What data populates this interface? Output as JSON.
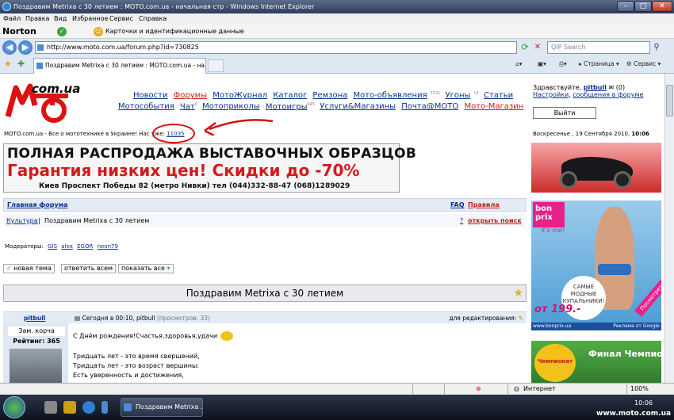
{
  "window": {
    "title": "Поздравим Metrixa с 30 летием : MOTO.com.ua - начальная стр - Windows Internet Explorer"
  },
  "menu": [
    "Файл",
    "Правка",
    "Вид",
    "Избранное",
    "Сервис",
    "Справка"
  ],
  "norton": {
    "logo": "Norton",
    "identity": "Карточки и идентификационные данные"
  },
  "address": {
    "url": "http://www.moto.com.ua/forum.php?id=730825",
    "search_placeholder": "QIP Search"
  },
  "tab": {
    "label": "Поздравим Metrixa с 30 летием : MOTO.com.ua - на..."
  },
  "tools": {
    "page": "Страница",
    "service": "Сервис"
  },
  "site": {
    "logo": "com.ua",
    "nav_row1": [
      {
        "label": "Новости",
        "sup": ""
      },
      {
        "label": "Форумы",
        "sup": ""
      },
      {
        "label": "МотоЖурнал",
        "sup": ""
      },
      {
        "label": "Каталог",
        "sup": ""
      },
      {
        "label": "Ремзона",
        "sup": ""
      },
      {
        "label": "Мото-объявления",
        "sup": "1531"
      },
      {
        "label": "Угоны",
        "sup": "14"
      },
      {
        "label": "Статьи",
        "sup": ""
      }
    ],
    "nav_row2": [
      {
        "label": "Мотособытия",
        "sup": ""
      },
      {
        "label": "Чат",
        "sup": "0"
      },
      {
        "label": "Мотоприколы",
        "sup": ""
      },
      {
        "label": "Мотоигры",
        "sup": "445"
      },
      {
        "label": "Услуги&Магазины",
        "sup": ""
      },
      {
        "label": "Почта@MOTO",
        "sup": ""
      },
      {
        "label": "Мото-Магазин",
        "sup": ""
      }
    ],
    "tagline": "MOTO.com.ua - Все о мототехнике в Украине!  Нас уже:",
    "user_count": "11035",
    "greeting": "Здравствуйте,",
    "username": "pitbull",
    "pm_count": "(0)",
    "settings": "Настройки",
    "forum_msgs": "сообщения в форуме",
    "logout": "Выйти",
    "date": "Воскресенье , 19 Сентября 2010,",
    "time": "10:06"
  },
  "banner": {
    "line1": "ПОЛНАЯ РАСПРОДАЖА ВЫСТАВОЧНЫХ ОБРАЗЦОВ",
    "line2": "Гарантия низких цен! Скидки до -70%",
    "line3": "Киев  Проспект Победы 82 (метро Нивки) тел (044)332-88-47 (068)1289029"
  },
  "ads": {
    "bonprix_logo": "bon prix",
    "bonprix_tag": "it's me!",
    "bonprix_circle": "САМЫЕ МОДНЫЕ КУПАЛЬНИКИ!",
    "bonprix_ribbon": "Посмотреть!",
    "bonprix_price": "от 199.-",
    "bonprix_url": "www.bonprix.ua",
    "bonprix_google": "Реклама от Google",
    "ksk_logo": "Чемпионат",
    "ksk_text": "Финал Чемпионата КСК"
  },
  "forum": {
    "main": "Главная форума",
    "faq": "FAQ",
    "rules": "Правила форума",
    "category": "Культура",
    "thread_crumb": "Поздравим Metrixa с 30 летием",
    "help": "?",
    "search": "открыть поиск",
    "mods_label": "Модераторы:",
    "mods": [
      "GIS",
      "alex",
      "EGOR",
      "neon79"
    ],
    "btn_new": "новая тема",
    "btn_reply": "ответить всем",
    "btn_show": "показать все",
    "thread_title": "Поздравим Metrixa с 30 летием"
  },
  "post": {
    "author": "pitbull",
    "date": "Сегодня в 00:10, pitbull",
    "views": "(просмотров: 33)",
    "edit": "для редактирования:",
    "rank": "Зам. корча",
    "rating": "Рейтинг: 365",
    "line1": "С Днём рождения!Счастья,здоровья,удачи",
    "line2": "Тридцать лет - это время свершений,",
    "line3": "Тридцать лет - это возраст вершины:",
    "line4": "Есть уверенность и достижения,"
  },
  "status": {
    "zone": "Интернет",
    "zoom": "100%"
  },
  "taskbar": {
    "item": "Поздравим Metrixa ...",
    "clock": "10:06",
    "watermark": "www.moto.com.ua"
  }
}
